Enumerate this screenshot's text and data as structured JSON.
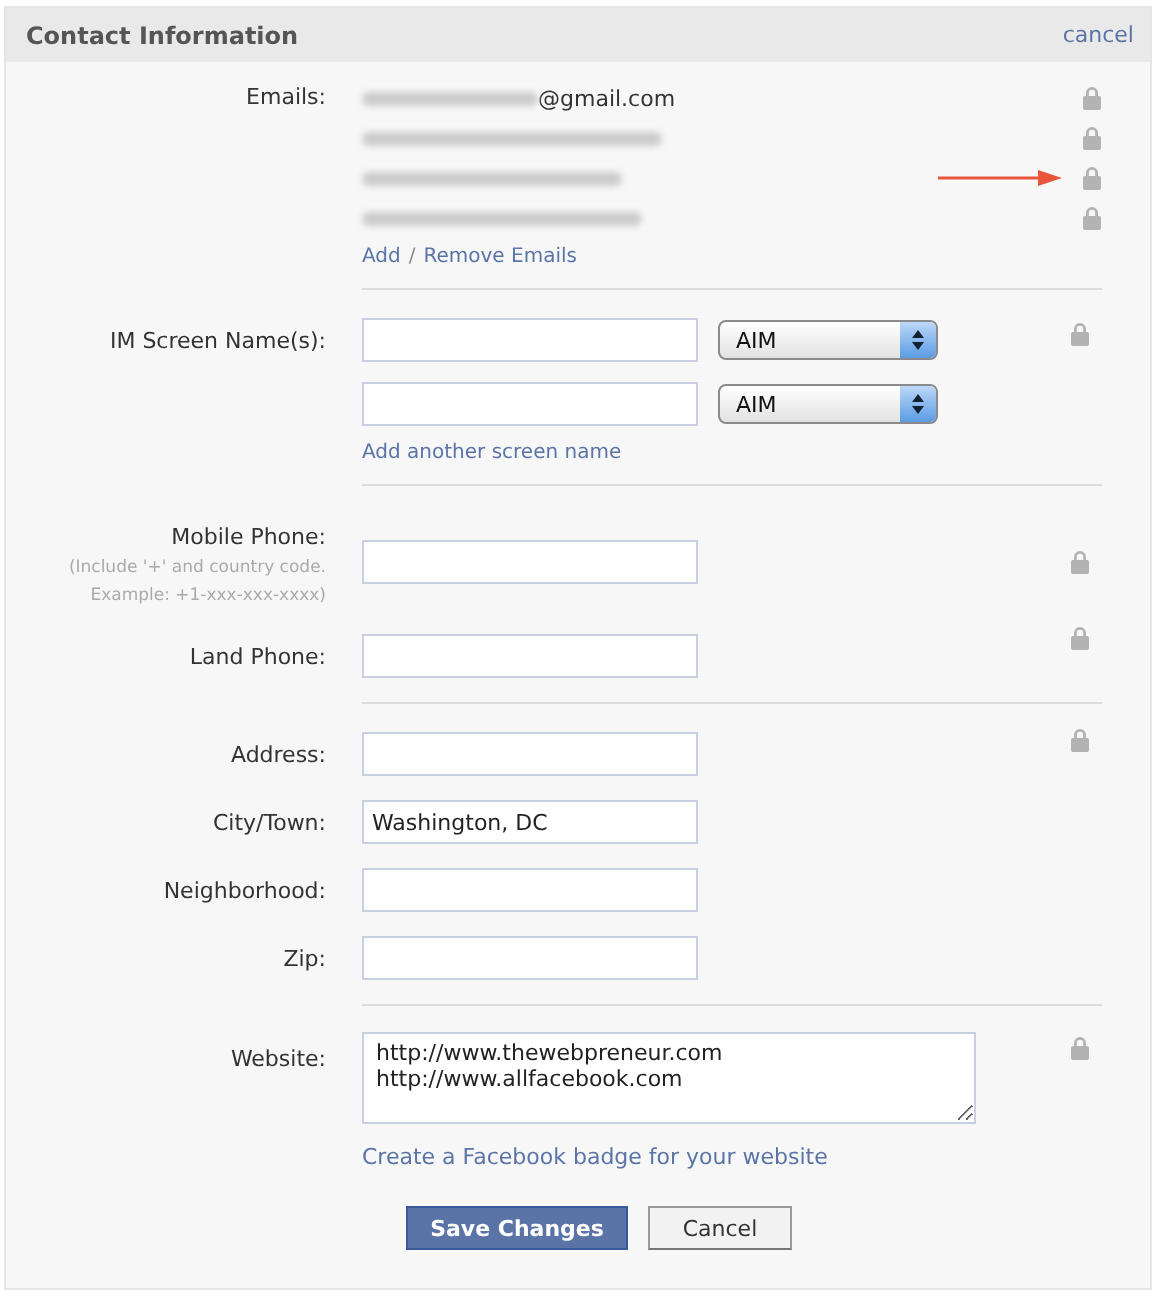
{
  "header": {
    "title": "Contact Information",
    "cancel": "cancel"
  },
  "emails": {
    "label": "Emails:",
    "items": [
      {
        "kind": "partial",
        "text": "@gmail.com",
        "arrow": false
      },
      {
        "kind": "redacted",
        "arrow": false
      },
      {
        "kind": "redacted",
        "arrow": true
      },
      {
        "kind": "redacted",
        "arrow": false
      }
    ],
    "link_add": "Add",
    "link_sep": "/",
    "link_remove": "Remove Emails"
  },
  "im": {
    "label": "IM Screen Name(s):",
    "items": [
      {
        "service": "AIM"
      },
      {
        "service": "AIM"
      }
    ],
    "link": "Add another screen name"
  },
  "phones": {
    "mobile_label": "Mobile Phone:",
    "mobile_hint": "(Include '+' and country code. Example: +1-xxx-xxx-xxxx)",
    "land_label": "Land Phone:"
  },
  "address": {
    "fields": [
      {
        "label": "Address:"
      },
      {
        "label": "City/Town:",
        "value": "Washington, DC"
      },
      {
        "label": "Neighborhood:"
      },
      {
        "label": "Zip:"
      }
    ]
  },
  "website": {
    "label": "Website:",
    "lines": [
      "http://www.thewebpreneur.com",
      "http://www.allfacebook.com"
    ],
    "link": "Create a Facebook badge for your website"
  },
  "buttons": {
    "save": "Save Changes",
    "cancel": "Cancel"
  }
}
